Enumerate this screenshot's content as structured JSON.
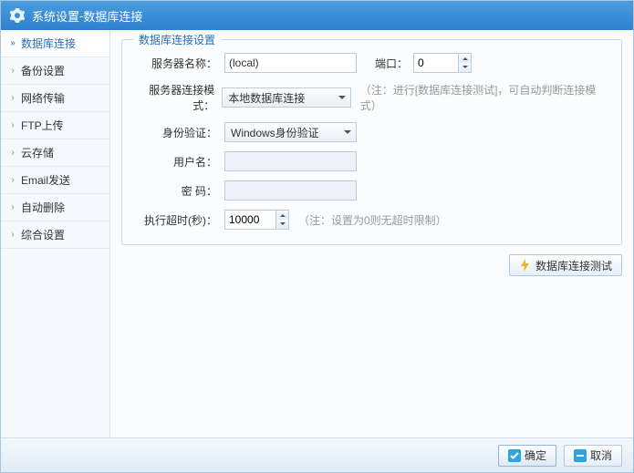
{
  "title": {
    "app": "系统设置",
    "sep": " - ",
    "page": "数据库连接"
  },
  "sidebar": {
    "items": [
      {
        "label": "数据库连接"
      },
      {
        "label": "备份设置"
      },
      {
        "label": "网络传输"
      },
      {
        "label": "FTP上传"
      },
      {
        "label": "云存储"
      },
      {
        "label": "Email发送"
      },
      {
        "label": "自动删除"
      },
      {
        "label": "综合设置"
      }
    ]
  },
  "panel": {
    "legend": "数据库连接设置",
    "server_label": "服务器名称：",
    "server_value": "(local)",
    "port_label": "端口：",
    "port_value": "0",
    "mode_label": "服务器连接模式：",
    "mode_value": "本地数据库连接",
    "mode_hint": "（注：进行[数据库连接测试]，可自动判断连接模式）",
    "auth_label": "身份验证：",
    "auth_value": "Windows身份验证",
    "user_label": "用户名：",
    "user_value": "",
    "pwd_label": "密  码：",
    "pwd_value": "",
    "timeout_label": "执行超时(秒)：",
    "timeout_value": "10000",
    "timeout_hint": "（注：设置为0则无超时限制）"
  },
  "actions": {
    "test": "数据库连接测试",
    "ok": "确定",
    "cancel": "取消"
  }
}
